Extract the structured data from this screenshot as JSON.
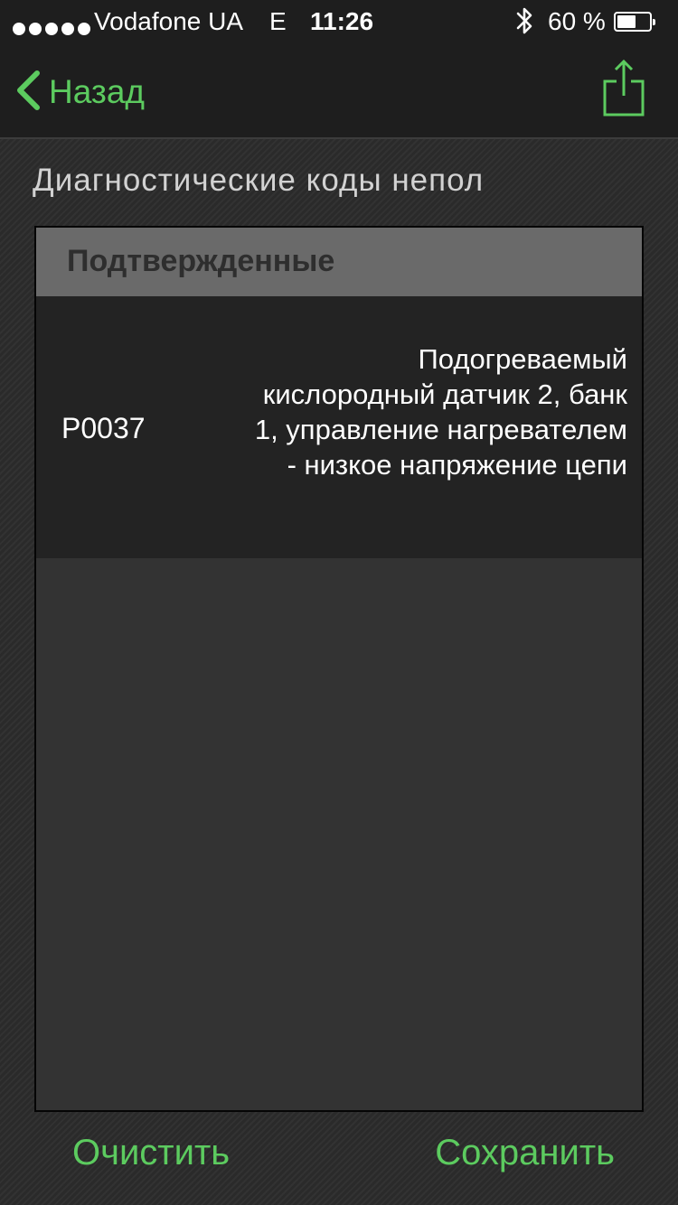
{
  "status_bar": {
    "carrier": "Vodafone UA",
    "network": "E",
    "time": "11:26",
    "battery_percent": "60 %",
    "battery_level": 0.6,
    "signal_bars": 5
  },
  "nav": {
    "back_label": "Назад",
    "back_icon": "chevron-left-icon",
    "share_icon": "share-icon"
  },
  "title": "Диагностические коды непол",
  "section": {
    "header": "Подтвержденные",
    "codes": [
      {
        "code": "P0037",
        "description": "Подогреваемый кислородный датчик 2, банк 1, управление нагревателем - низкое напряжение цепи"
      }
    ]
  },
  "actions": {
    "clear_label": "Очистить",
    "save_label": "Сохранить"
  },
  "colors": {
    "accent": "#5ccb5f",
    "header_bg": "#6a6a6a",
    "row_bg": "#232323",
    "panel_bg": "#333333"
  }
}
